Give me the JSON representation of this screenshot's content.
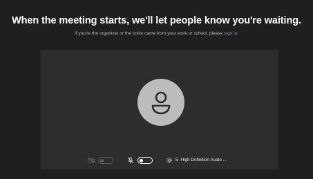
{
  "header": {
    "title": "When the meeting starts, we'll let people know you're waiting.",
    "subtitle_prefix": "If you're the organizer or the invite came from your work or school, please ",
    "sign_in_link": "sign in",
    "subtitle_suffix": "."
  },
  "preview": {
    "avatar_icon": "person-icon",
    "controls": {
      "video_icon": "camera-off-icon",
      "video_toggle_on": false,
      "mic_icon": "mic-off-icon",
      "mic_toggle_on": false,
      "settings_icon": "gear-icon",
      "audio_device_label": "5- High Definition Audio ..."
    }
  },
  "colors": {
    "background": "#1f1f1f",
    "stage": "#2d2d2d",
    "avatar": "#bcbcbc",
    "link": "#8b8cc7"
  }
}
